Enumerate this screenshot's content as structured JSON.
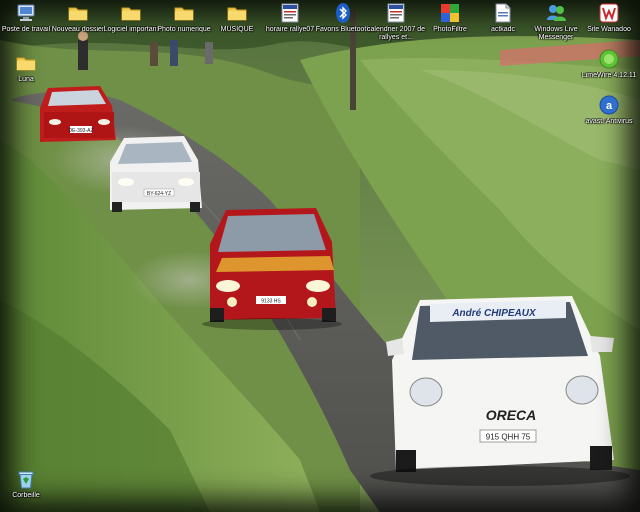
{
  "desktop": {
    "icons": [
      {
        "label": "Poste de travail",
        "icon": "computer-icon"
      },
      {
        "label": "Nouveau dossier",
        "icon": "folder-icon"
      },
      {
        "label": "Logiciel important",
        "icon": "folder-icon"
      },
      {
        "label": "Photo numerique",
        "icon": "folder-icon"
      },
      {
        "label": "MUSIQUE",
        "icon": "folder-icon"
      },
      {
        "label": "horaire rallye07",
        "icon": "document-icon"
      },
      {
        "label": "Favoris Bluetooth",
        "icon": "bluetooth-icon"
      },
      {
        "label": "calendrier 2007 de rallyes et...",
        "icon": "document-icon"
      },
      {
        "label": "PhotoFiltre",
        "icon": "photofiltre-icon"
      },
      {
        "label": "actkadc",
        "icon": "document-icon"
      },
      {
        "label": "Windows Live Messenger",
        "icon": "messenger-icon"
      },
      {
        "label": "Site Wanadoo",
        "icon": "wanadoo-icon"
      },
      {
        "label": "Luna",
        "icon": "folder-icon"
      },
      {
        "label": "LimeWire 4.12.11",
        "icon": "limewire-icon"
      },
      {
        "label": "avast! Antivirus",
        "icon": "avast-icon"
      },
      {
        "label": "Corbeille",
        "icon": "recycle-bin-icon"
      }
    ],
    "car_plates": {
      "car_1": "DE-393-AZ",
      "car_2": "BY-624-YZ",
      "car_3": "9133 HS",
      "car_4": "915 QHH 75"
    },
    "car_4_banner": "André CHIPEAUX",
    "car_4_sponsor": "ORECA"
  },
  "colors": {
    "label_text": "#ffffff",
    "road": "#5e5e5a",
    "grass": "#7fa04f"
  }
}
